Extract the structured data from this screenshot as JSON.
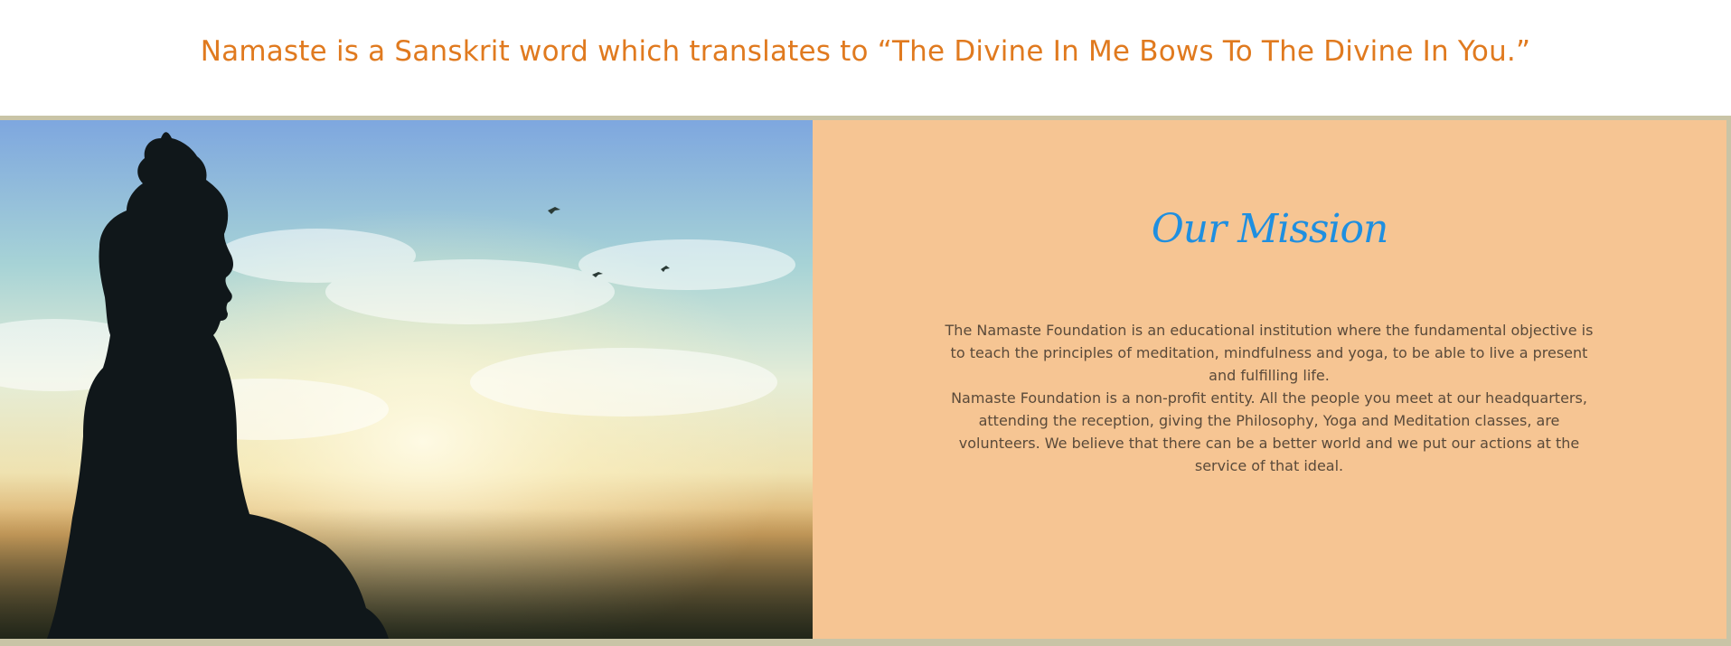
{
  "header": {
    "tagline": "Namaste is a Sanskrit word which translates to “The Divine In Me Bows To The Divine In You.”"
  },
  "hero_image": {
    "description_icon": "buddha-silhouette-sunset-image"
  },
  "mission": {
    "title": "Our Mission",
    "paragraph_1": "The Namaste Foundation is an educational institution where the fundamental objective is to teach the principles of meditation, mindfulness and yoga, to be able to live a present and fulfilling life.",
    "paragraph_2": "Namaste Foundation is a non-profit entity. All the people you meet at our headquarters, attending the reception, giving the Philosophy, Yoga and Meditation classes, are volunteers. We believe that there can be a better world and we put our actions at the service of that ideal."
  },
  "colors": {
    "tagline": "#e07a1f",
    "panel_background": "#f6c593",
    "mission_title": "#1f8fe0",
    "mission_text": "#5a4a3a",
    "border": "#c9c4a6"
  }
}
